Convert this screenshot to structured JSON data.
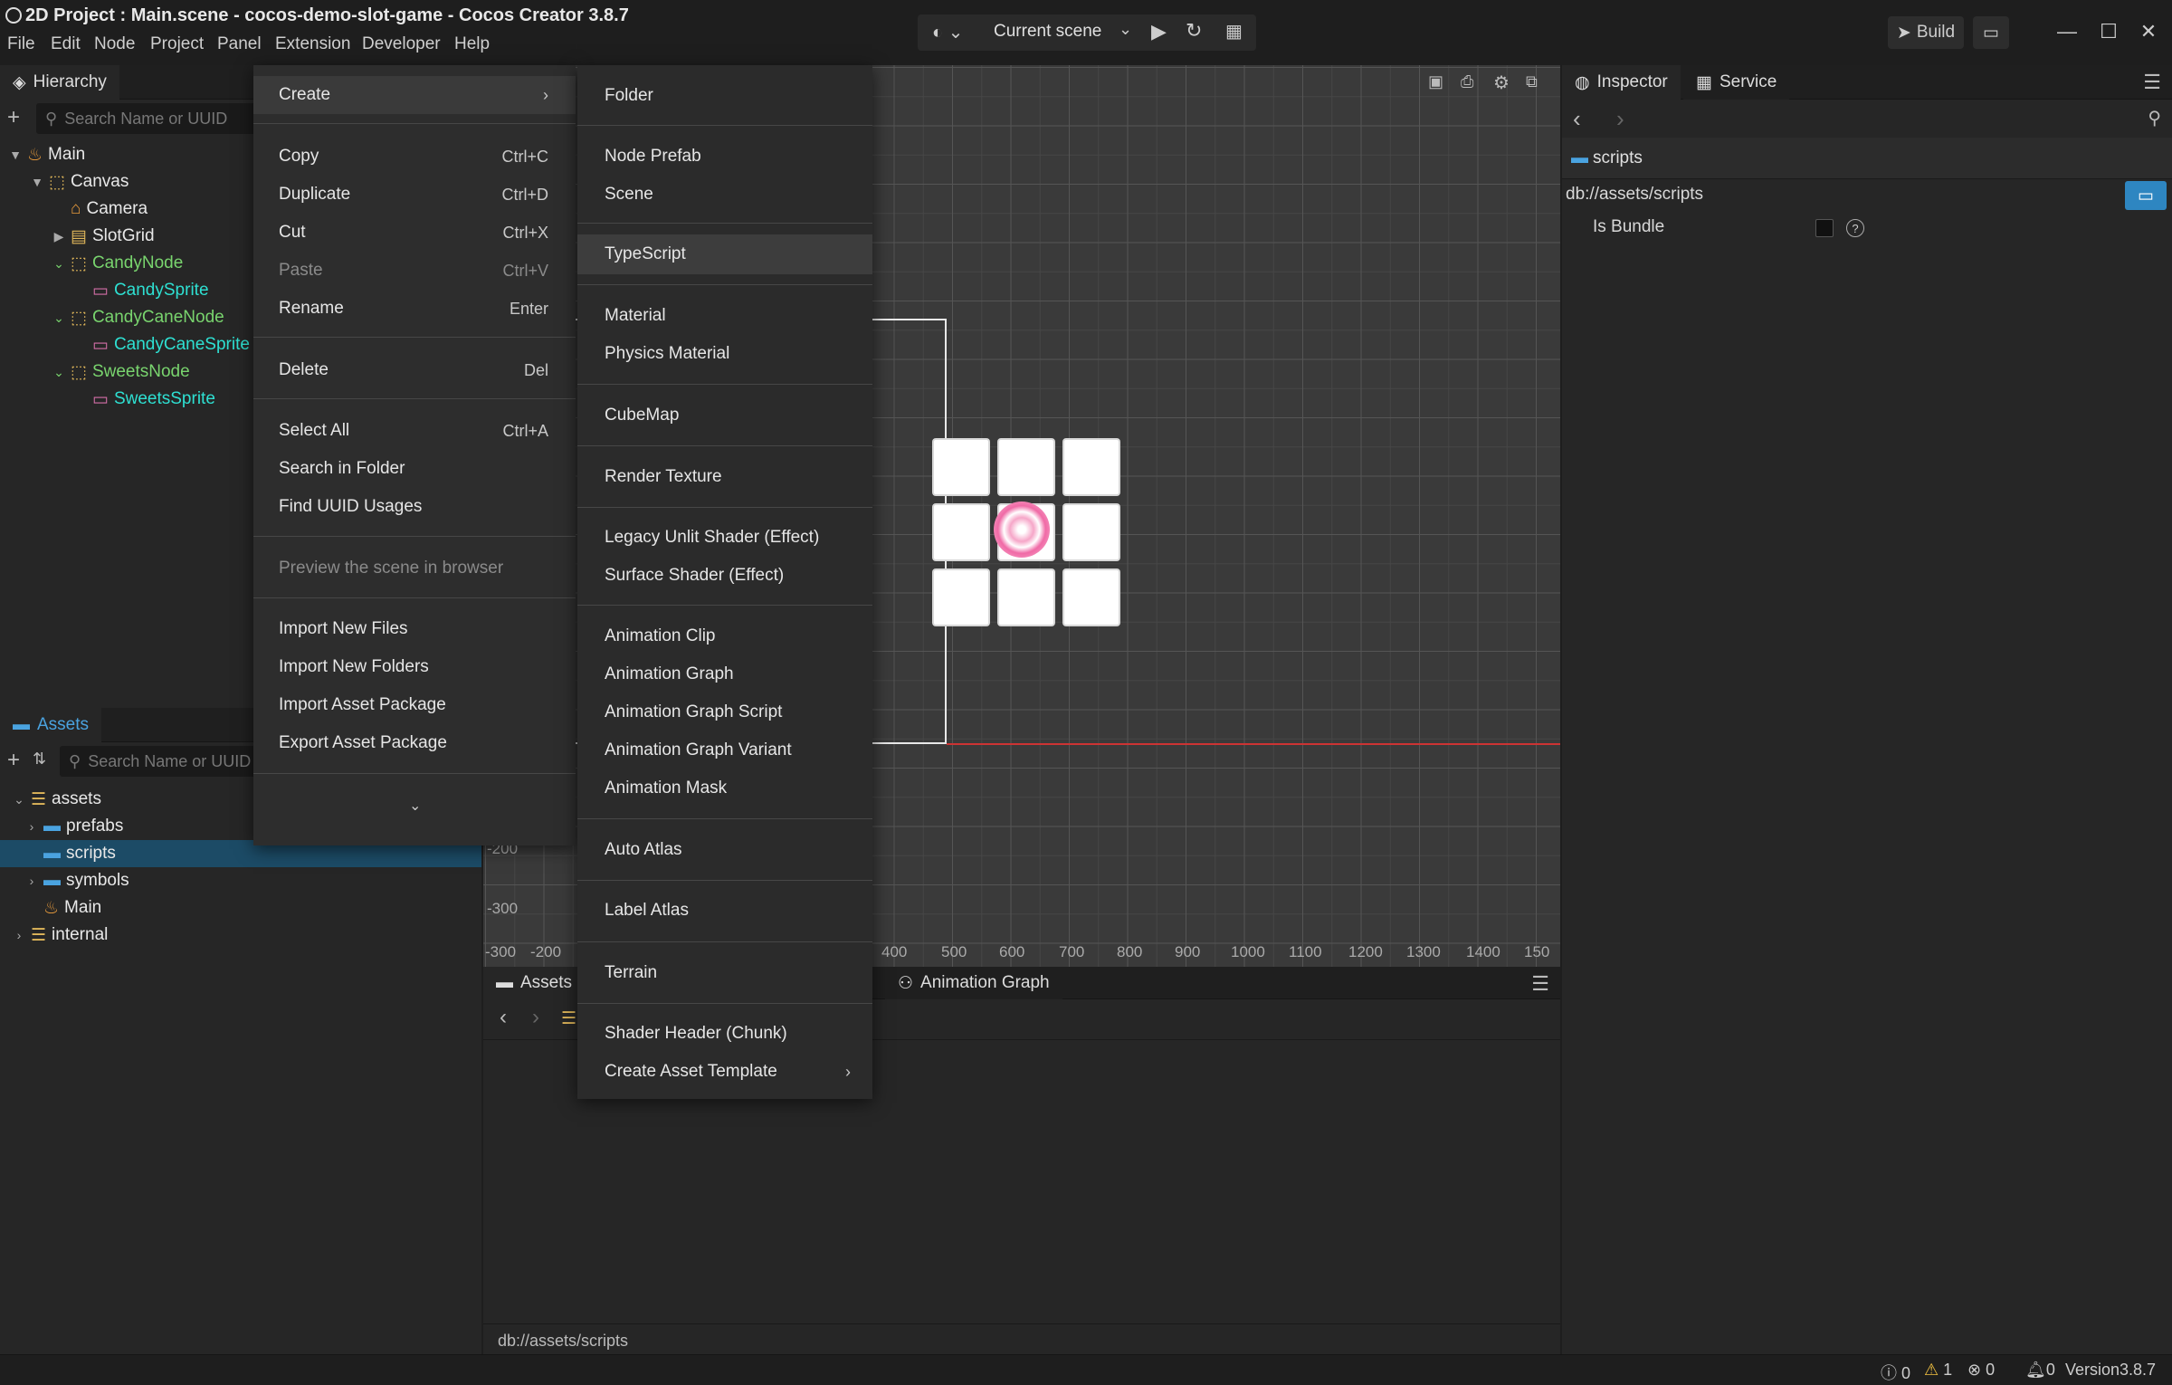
{
  "window": {
    "title": "2D Project : Main.scene - cocos-demo-slot-game - Cocos Creator 3.8.7"
  },
  "menubar": [
    "File",
    "Edit",
    "Node",
    "Project",
    "Panel",
    "Extension",
    "Developer",
    "Help"
  ],
  "toolbar": {
    "scene_select": "Current scene",
    "build_label": "Build"
  },
  "hierarchy": {
    "tab": "Hierarchy",
    "search_placeholder": "Search Name or UUID",
    "nodes": [
      {
        "label": "Main"
      },
      {
        "label": "Canvas"
      },
      {
        "label": "Camera"
      },
      {
        "label": "SlotGrid"
      },
      {
        "label": "CandyNode"
      },
      {
        "label": "CandySprite"
      },
      {
        "label": "CandyCaneNode"
      },
      {
        "label": "CandyCaneSprite"
      },
      {
        "label": "SweetsNode"
      },
      {
        "label": "SweetsSprite"
      }
    ]
  },
  "assets": {
    "tab": "Assets",
    "search_placeholder": "Search Name or UUID",
    "tree": [
      {
        "label": "assets"
      },
      {
        "label": "prefabs"
      },
      {
        "label": "scripts"
      },
      {
        "label": "symbols"
      },
      {
        "label": "Main"
      },
      {
        "label": "internal"
      }
    ]
  },
  "scene": {
    "ruler_left": [
      "-200",
      "-300"
    ],
    "ruler_bottom": [
      "-300",
      "-200",
      "400",
      "500",
      "600",
      "700",
      "800",
      "900",
      "1000",
      "1100",
      "1200",
      "1300",
      "1400",
      "150"
    ]
  },
  "bottom_panel": {
    "tab_assets": "Assets",
    "tab_animation_graph": "Animation Graph",
    "path": "db://assets/scripts"
  },
  "inspector": {
    "tab": "Inspector",
    "tab_service": "Service",
    "folder_name": "scripts",
    "path": "db://assets/scripts",
    "is_bundle_label": "Is Bundle",
    "is_bundle_checked": false
  },
  "context_menu": {
    "items": [
      {
        "label": "Create",
        "shortcut": ""
      },
      {
        "label": "Copy",
        "shortcut": "Ctrl+C"
      },
      {
        "label": "Duplicate",
        "shortcut": "Ctrl+D"
      },
      {
        "label": "Cut",
        "shortcut": "Ctrl+X"
      },
      {
        "label": "Paste",
        "shortcut": "Ctrl+V"
      },
      {
        "label": "Rename",
        "shortcut": "Enter"
      },
      {
        "label": "Delete",
        "shortcut": "Del"
      },
      {
        "label": "Select All",
        "shortcut": "Ctrl+A"
      },
      {
        "label": "Search in Folder",
        "shortcut": ""
      },
      {
        "label": "Find UUID Usages",
        "shortcut": ""
      },
      {
        "label": "Preview the scene in browser",
        "shortcut": ""
      },
      {
        "label": "Import New Files",
        "shortcut": ""
      },
      {
        "label": "Import New Folders",
        "shortcut": ""
      },
      {
        "label": "Import Asset Package",
        "shortcut": ""
      },
      {
        "label": "Export Asset Package",
        "shortcut": ""
      }
    ]
  },
  "create_submenu": {
    "items": [
      "Folder",
      "Node Prefab",
      "Scene",
      "TypeScript",
      "Material",
      "Physics Material",
      "CubeMap",
      "Render Texture",
      "Legacy Unlit Shader (Effect)",
      "Surface Shader (Effect)",
      "Animation Clip",
      "Animation Graph",
      "Animation Graph Script",
      "Animation Graph Variant",
      "Animation Mask",
      "Auto Atlas",
      "Label Atlas",
      "Terrain",
      "Shader Header (Chunk)",
      "Create Asset Template"
    ],
    "highlighted": "TypeScript"
  },
  "status": {
    "info_count": "0",
    "warn_count": "1",
    "error_count": "0",
    "notify_count": "0",
    "version": "Version3.8.7"
  },
  "colors": {
    "accent_blue": "#2e86c1",
    "node_green": "#79d46e",
    "sprite_cyan": "#2ee0d2",
    "selection": "#1c4b66"
  }
}
